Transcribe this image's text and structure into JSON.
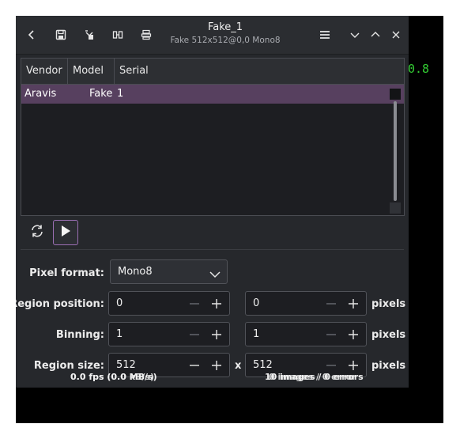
{
  "background_terminal": {
    "text": "0.8"
  },
  "window": {
    "title": "Fake_1",
    "subtitle": "Fake 512x512@0,0 Mono8"
  },
  "header_icons": [
    "back-icon",
    "save-icon",
    "snapshot-icon",
    "settings-icon",
    "camera-info-icon",
    "hamburger-menu-icon",
    "minimize-icon",
    "maximize-icon",
    "close-icon"
  ],
  "camera_table": {
    "columns": [
      "Vendor",
      "Model",
      "Serial"
    ],
    "rows": [
      {
        "vendor": "Aravis",
        "model": "Fake",
        "serial": "1"
      }
    ]
  },
  "form": {
    "pixel_format": {
      "label": "Pixel format:",
      "value": "Mono8"
    },
    "region_position": {
      "label": "Region position:",
      "x": "0",
      "y": "0",
      "unit": "pixels"
    },
    "binning": {
      "label": "Binning:",
      "x": "1",
      "y": "1",
      "unit": "pixels"
    },
    "region_size": {
      "label": "Region size:",
      "width": "512",
      "separator": "x",
      "height": "512",
      "unit": "pixels"
    }
  },
  "status": {
    "fps_a": "0.0 fps (0.0 MB/s)",
    "fps_b": "0.0 fps (0.0 kB/s)",
    "images_a": "10 images / 0 errors",
    "images_b": "0 images / 0 error"
  },
  "colors": {
    "selection": "#57405f",
    "accent": "#9b6fb4",
    "window_bg": "#26282c",
    "terminal_text": "#33cc33"
  }
}
